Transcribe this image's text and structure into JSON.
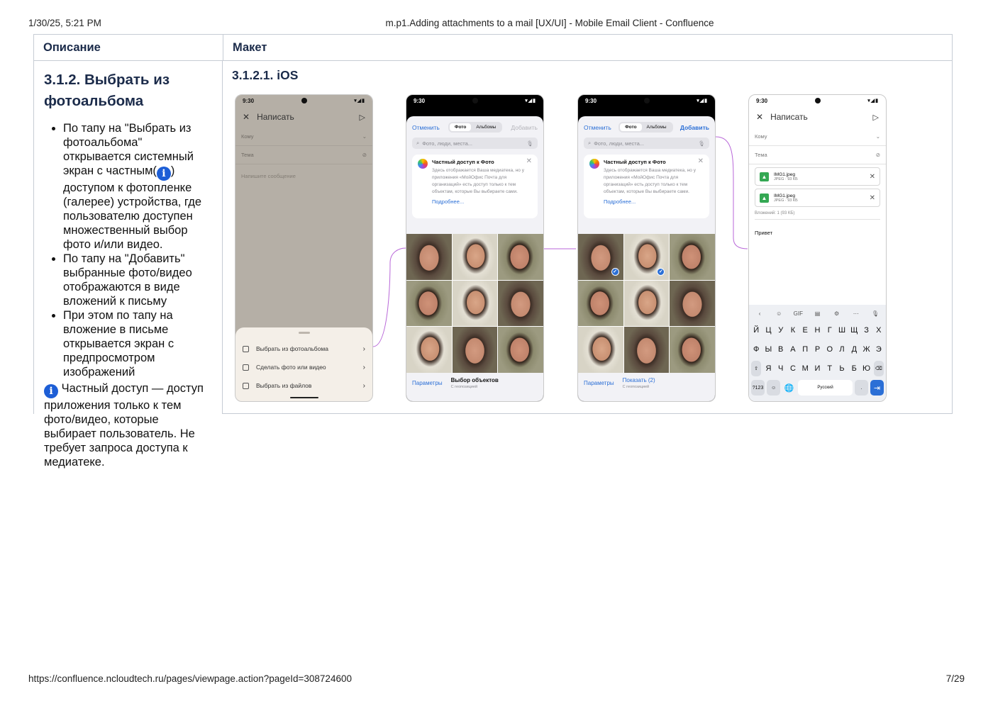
{
  "print_header": {
    "datetime": "1/30/25, 5:21 PM",
    "title": "m.p1.Adding attachments to a mail [UX/UI] - Mobile Email Client - Confluence"
  },
  "print_footer": {
    "url": "https://confluence.ncloudtech.ru/pages/viewpage.action?pageId=308724600",
    "page": "7/29"
  },
  "table": {
    "col_description": "Описание",
    "col_mockup": "Макет"
  },
  "section": {
    "title": "3.1.2.  Выбрать из фотоальбома",
    "bullet_1a": "По тапу на \"Выбрать из фотоальбома\" открывается системный экран с частным(",
    "bullet_1b": ") доступом к фотопленке (галерее) устройства, где пользователю доступен множественный выбор фото и/или видео.",
    "bullet_2": "По тапу на \"Добавить\" выбранные фото/видео отображаются в виде вложений к письму",
    "bullet_3": "При этом по тапу на вложение в письме открывается экран с предпросмотром изображений",
    "info_glyph": "i",
    "note": " Частный доступ — доступ приложения только к тем фото/видео, которые выбирает пользователь. Не требует запроса доступа к медиатеке."
  },
  "mockup": {
    "subtitle": "3.1.2.1. iOS",
    "time": "9:30",
    "phone1": {
      "title": "Написать",
      "to": "Кому",
      "subject": "Тема",
      "body_placeholder": "Напишите сообщение",
      "sheet_items": [
        "Выбрать из фотоальбома",
        "Сделать фото или видео",
        "Выбрать из файлов"
      ]
    },
    "picker": {
      "cancel": "Отменить",
      "tab_photo": "Фото",
      "tab_albums": "Альбомы",
      "add": "Добавить",
      "search": "Фото, люди, места...",
      "card_title": "Частный доступ к Фото",
      "card_body": "Здесь отображается Ваша медиатека, но у приложения «МойОфис Почта для организаций» есть доступ только к тем объектам, которые Вы выбираете сами.",
      "card_link": "Подробнее...",
      "params": "Параметры",
      "choose": "Выбор объектов",
      "show": "Показать (2)",
      "geo": "С геопозицией"
    },
    "phone4": {
      "title": "Написать",
      "to": "Кому",
      "subject": "Тема",
      "attachments": [
        {
          "name": "IMG1.jpeg",
          "meta": "JPEG · 93 КБ"
        },
        {
          "name": "IMG1.jpeg",
          "meta": "JPEG · 93 КБ"
        }
      ],
      "attach_summary": "Вложений: 1 (93 КБ)",
      "body": "Привет",
      "kbd_row1": [
        "Й",
        "Ц",
        "У",
        "К",
        "Е",
        "Н",
        "Г",
        "Ш",
        "Щ",
        "З",
        "Х"
      ],
      "kbd_row2": [
        "Ф",
        "Ы",
        "В",
        "А",
        "П",
        "Р",
        "О",
        "Л",
        "Д",
        "Ж",
        "Э"
      ],
      "kbd_row3": [
        "Я",
        "Ч",
        "С",
        "М",
        "И",
        "Т",
        "Ь",
        "Б",
        "Ю"
      ],
      "kbd_num": "?123",
      "kbd_lang": "Русский",
      "kbd_dot": ".",
      "kbd_gif": "GIF"
    }
  },
  "colors": {
    "heading": "#1b2b4a",
    "accent_blue": "#2b6fd6",
    "info_icon": "#1d5ed6",
    "flow_arrow": "#b866d8"
  }
}
